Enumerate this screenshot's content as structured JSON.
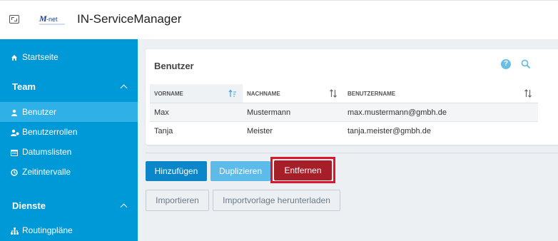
{
  "header": {
    "title": "IN-ServiceManager",
    "logo_text": "M-net"
  },
  "sidebar": {
    "items": [
      {
        "label": "Startseite",
        "icon": "home-icon"
      },
      {
        "section": "Team"
      },
      {
        "label": "Benutzer",
        "icon": "user-icon",
        "active": true
      },
      {
        "label": "Benutzerrollen",
        "icon": "user-roles-icon"
      },
      {
        "label": "Datumslisten",
        "icon": "calendar-icon"
      },
      {
        "label": "Zeitintervalle",
        "icon": "clock-icon"
      },
      {
        "section": "Dienste"
      },
      {
        "label": "Routingpläne",
        "icon": "sitemap-icon"
      }
    ]
  },
  "card": {
    "title": "Benutzer",
    "columns": [
      "VORNAME",
      "NACHNAME",
      "BENUTZERNAME"
    ],
    "rows": [
      [
        "Max",
        "Mustermann",
        "max.mustermann@gmbh.de"
      ],
      [
        "Tanja",
        "Meister",
        "tanja.meister@gmbh.de"
      ]
    ]
  },
  "actions": {
    "add": "Hinzufügen",
    "duplicate": "Duplizieren",
    "remove": "Entfernen",
    "import": "Importieren",
    "download_template": "Importvorlage herunterladen"
  },
  "colors": {
    "sidebar": "#0099d8",
    "primary": "#0b86c8",
    "danger": "#a51e28",
    "highlight": "#e0142a"
  }
}
